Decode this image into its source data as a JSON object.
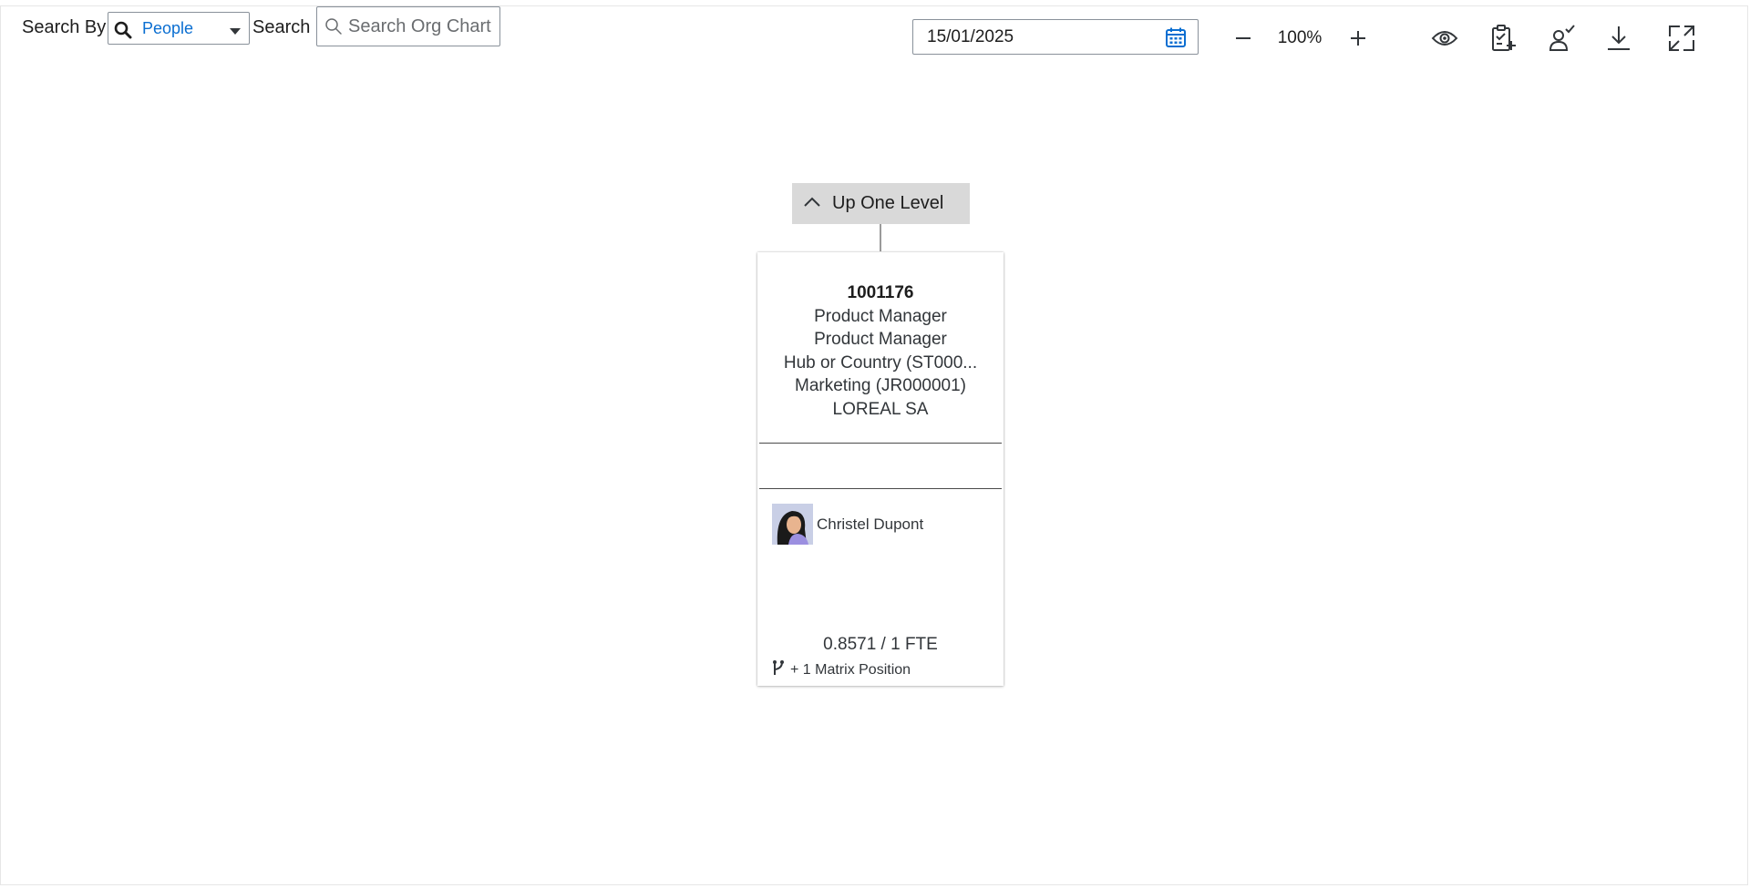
{
  "toolbar": {
    "search_by_label": "Search By",
    "search_by_value": "People",
    "search_label": "Search",
    "search_placeholder": "Search Org Chart",
    "date_value": "15/01/2025",
    "zoom_level": "100%",
    "icons": [
      "search-icon",
      "calendar-icon",
      "minus-icon",
      "plus-icon",
      "eye-icon",
      "clipboard-add-icon",
      "person-check-icon",
      "download-icon",
      "expand-icon"
    ]
  },
  "chart": {
    "up_level_label": "Up One Level",
    "card": {
      "position_id": "1001176",
      "line1": "Product Manager",
      "line2": "Product Manager",
      "line3": "Hub or Country (ST000...",
      "line4": "Marketing (JR000001)",
      "line5": "LOREAL SA",
      "incumbent_name": "Christel Dupont",
      "fte": "0.8571 / 1 FTE",
      "matrix_label": "+ 1 Matrix Position"
    }
  },
  "colors": {
    "accent": "#0a6ed1",
    "up_level_bg": "#d9d9d9",
    "text": "#32363a"
  }
}
